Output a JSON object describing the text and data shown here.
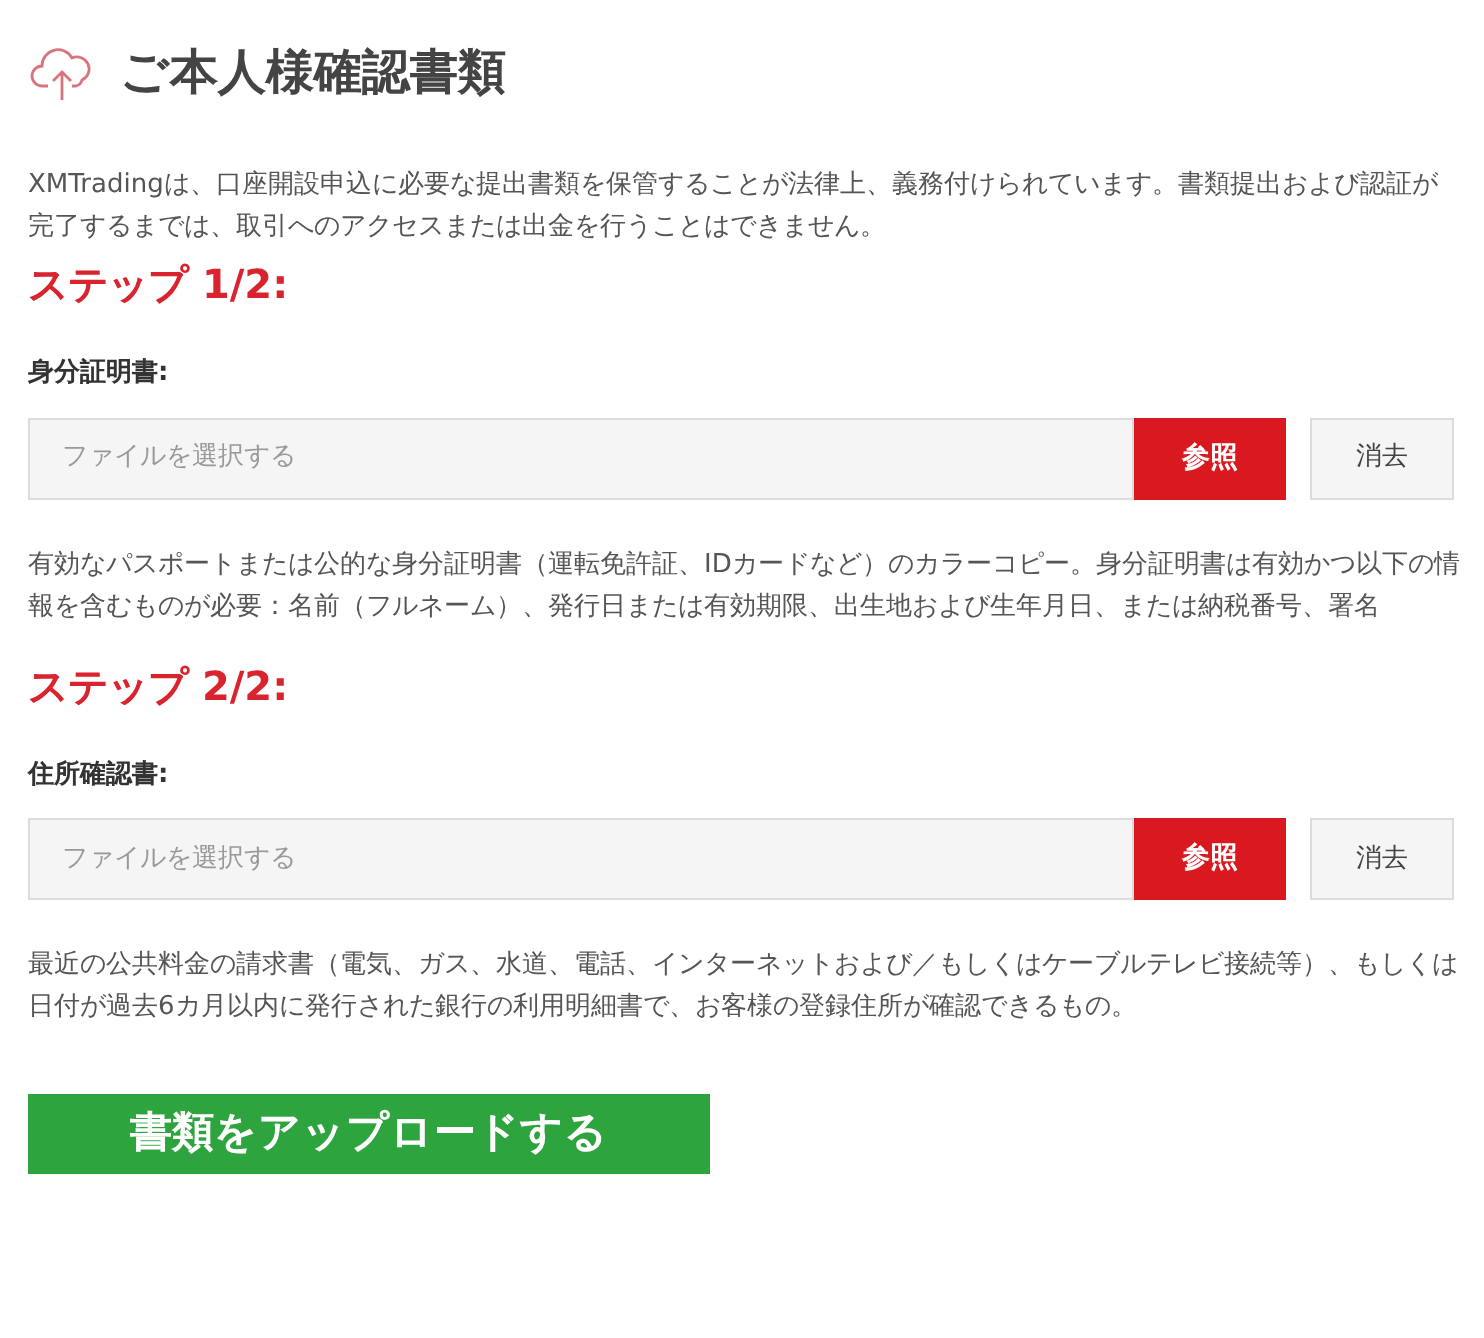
{
  "title": "ご本人様確認書類",
  "intro": "XMTradingは、口座開設申込に必要な提出書類を保管することが法律上、義務付けられています。書類提出および認証が完了するまでは、取引へのアクセスまたは出金を行うことはできません。",
  "steps": [
    {
      "heading": "ステップ 1/2:",
      "label": "身分証明書:",
      "placeholder": "ファイルを選択する",
      "browse": "参照",
      "clear": "消去",
      "description": "有効なパスポートまたは公的な身分証明書（運転免許証、IDカードなど）のカラーコピー。身分証明書は有効かつ以下の情報を含むものが必要：名前（フルネーム）、発行日または有効期限、出生地および生年月日、または納税番号、署名"
    },
    {
      "heading": "ステップ 2/2:",
      "label": "住所確認書:",
      "placeholder": "ファイルを選択する",
      "browse": "参照",
      "clear": "消去",
      "description": "最近の公共料金の請求書（電気、ガス、水道、電話、インターネットおよび／もしくはケーブルテレビ接続等）、もしくは日付が過去6カ月以内に発行された銀行の利用明細書で、お客様の登録住所が確認できるもの。"
    }
  ],
  "upload_button": "書類をアップロードする"
}
